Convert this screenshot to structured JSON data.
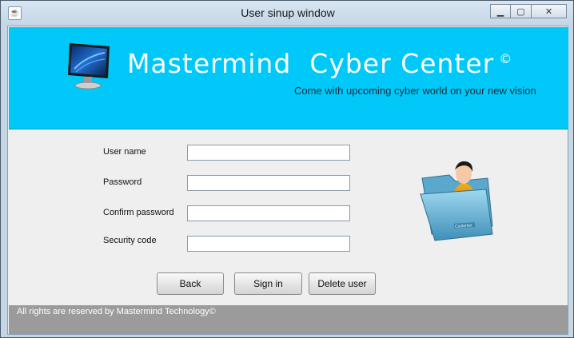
{
  "window": {
    "title": "User sinup window",
    "app_icon": "java-icon",
    "minimize_glyph": "▁",
    "maximize_glyph": "▢",
    "close_glyph": "✕"
  },
  "header": {
    "title": "Mastermind  Cyber Center",
    "copyright_mark": "©",
    "tagline": "Come with upcoming cyber world on your new vision",
    "background": "#00c8f8",
    "logo_icon": "monitor-icon"
  },
  "form": {
    "fields": [
      {
        "label": "User name",
        "value": ""
      },
      {
        "label": "Password",
        "value": ""
      },
      {
        "label": "Confirm password",
        "value": ""
      },
      {
        "label": "Security code",
        "value": ""
      }
    ]
  },
  "buttons": {
    "back": "Back",
    "sign_in": "Sign in",
    "delete_user": "Delete user"
  },
  "illustration": {
    "icon": "user-folder-icon",
    "folder_label": "Customer"
  },
  "footer": {
    "text": "All rights are reserved by Mastermind Technology©",
    "background": "#9b9b9b"
  }
}
